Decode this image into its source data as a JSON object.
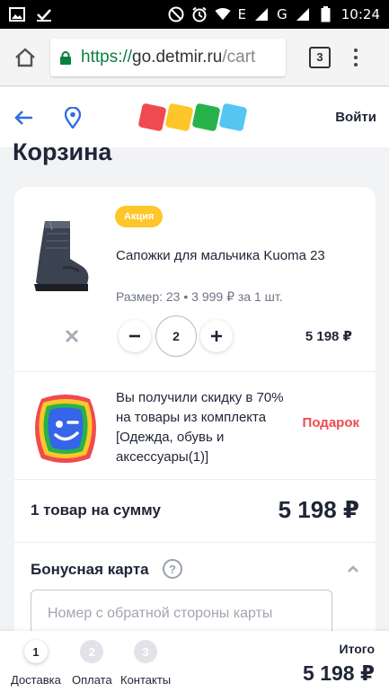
{
  "status_bar": {
    "time": "10:24",
    "network": "E",
    "network2": "G",
    "icons": [
      "image-icon",
      "check-icon",
      "dnd-icon",
      "alarm-icon",
      "wifi-icon",
      "signal-icon",
      "battery-icon"
    ]
  },
  "browser": {
    "url_scheme": "https://",
    "url_host": "go.detmir.ru",
    "url_path": "/cart",
    "tab_count": "3"
  },
  "header": {
    "login_label": "Войти",
    "logo_colors": [
      "#f04a50",
      "#ffc629",
      "#28b34a",
      "#55c5f2"
    ]
  },
  "page": {
    "title": "Корзина"
  },
  "cart": {
    "item": {
      "badge": "Акция",
      "name": "Сапожки для мальчика Kuoma 23",
      "meta": "Размер: 23 • 3 999 ₽ за 1 шт.",
      "quantity": "2",
      "line_total": "5 198 ₽"
    },
    "gift": {
      "description": "Вы получили скидку в 70% на товары из комплекта [Одежда, обувь и аксессуары(1)]",
      "link": "Подарок"
    },
    "summary": {
      "label": "1 товар на сумму",
      "total": "5 198 ₽"
    },
    "bonus": {
      "title": "Бонусная карта",
      "help": "?",
      "placeholder": "Номер с обратной стороны карты"
    }
  },
  "checkout": {
    "steps": [
      {
        "number": "1",
        "label": "Доставка"
      },
      {
        "number": "2",
        "label": "Оплата"
      },
      {
        "number": "3",
        "label": "Контакты"
      }
    ],
    "total_label": "Итого",
    "total_value": "5 198 ₽"
  },
  "colors": {
    "accent_red": "#f04a50",
    "badge_yellow": "#ffc629",
    "text_dark": "#1f2536",
    "link_blue": "#2f6fe0"
  }
}
